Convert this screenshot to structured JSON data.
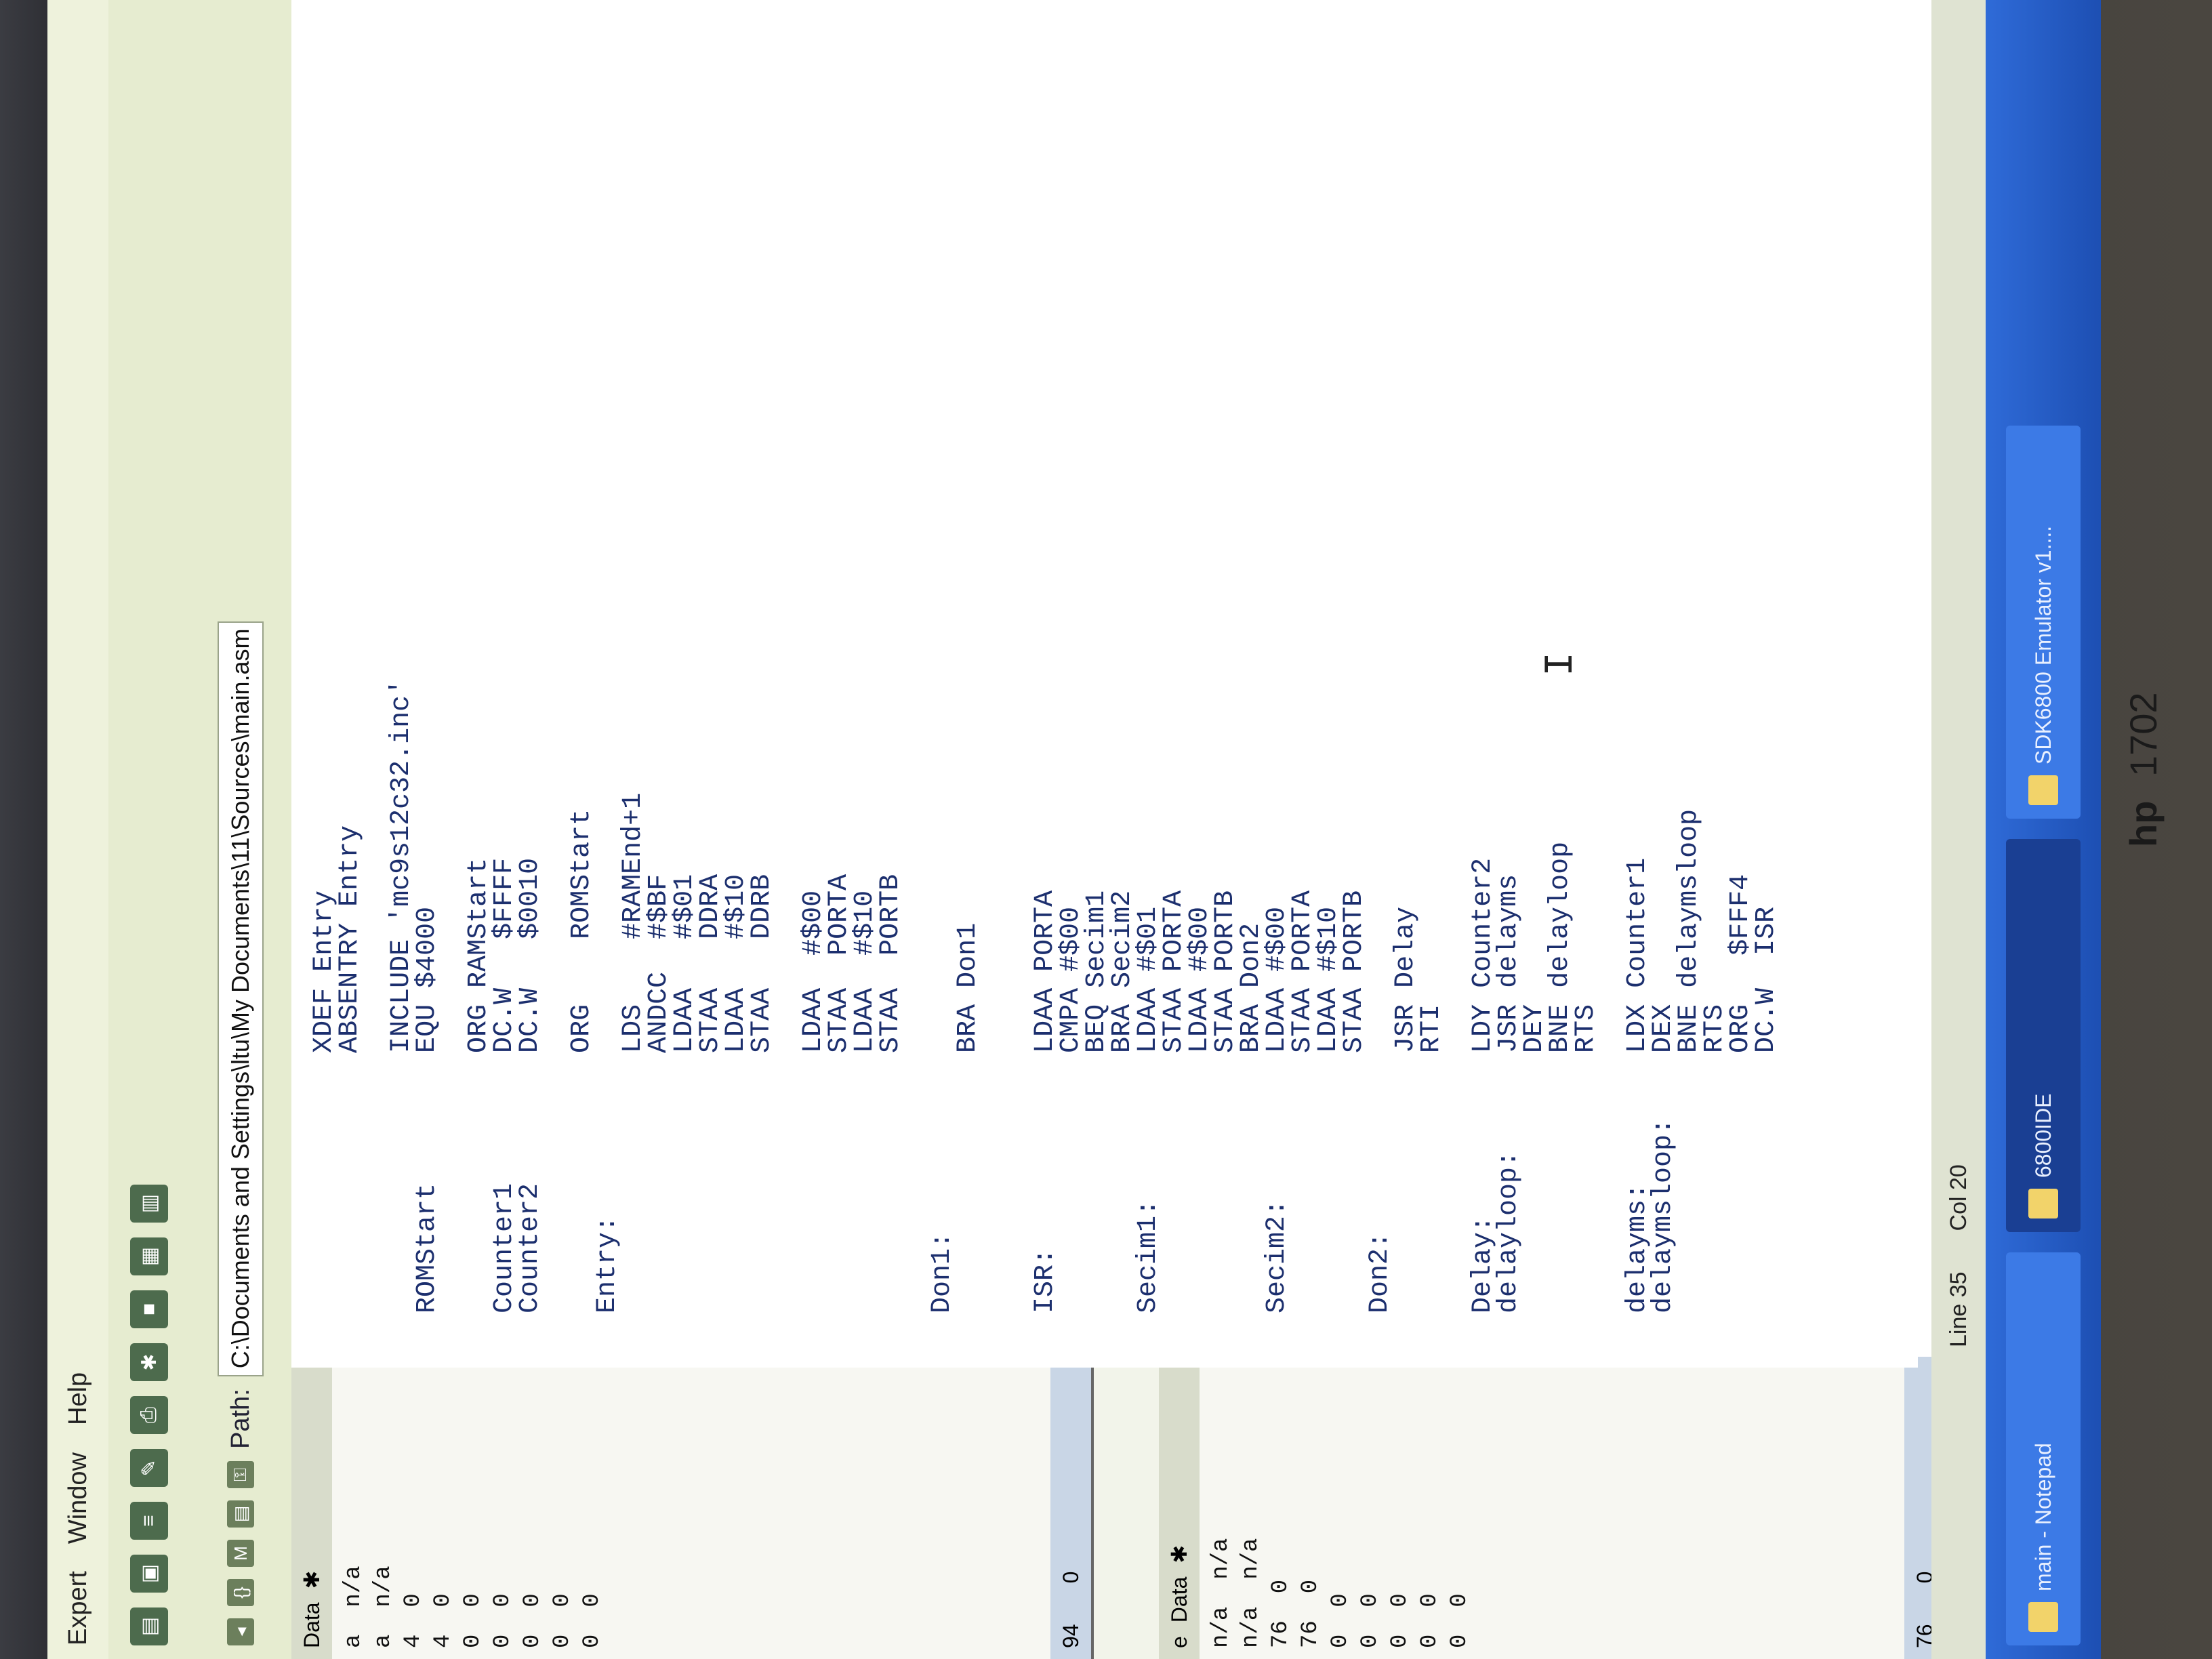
{
  "menu": {
    "items": [
      "Expert",
      "Window",
      "Help"
    ]
  },
  "path": {
    "label": "Path:",
    "value": "C:\\Documents and Settings\\ltu\\My Documents\\11\\Sources\\main.asm"
  },
  "left_panel_top": {
    "header": "Data",
    "rows": [
      {
        "a": "a",
        "b": "n/a"
      },
      {
        "a": "a",
        "b": "n/a"
      },
      {
        "a": "4",
        "b": "0"
      },
      {
        "a": "4",
        "b": "0"
      },
      {
        "a": "0",
        "b": "0"
      },
      {
        "a": "0",
        "b": "0"
      },
      {
        "a": "0",
        "b": "0"
      },
      {
        "a": "0",
        "b": "0"
      },
      {
        "a": "0",
        "b": "0"
      }
    ],
    "footer_a": "94",
    "footer_b": "0"
  },
  "left_panel_bottom": {
    "header": "Data",
    "col_label": "e",
    "rows": [
      {
        "a": "n/a",
        "b": "n/a"
      },
      {
        "a": "n/a",
        "b": "n/a"
      },
      {
        "a": "76",
        "b": "0"
      },
      {
        "a": "76",
        "b": "0"
      },
      {
        "a": "0",
        "b": "0"
      },
      {
        "a": "0",
        "b": "0"
      },
      {
        "a": "0",
        "b": "0"
      },
      {
        "a": "0",
        "b": "0"
      },
      {
        "a": "0",
        "b": "0"
      }
    ],
    "footer_a": "76",
    "footer_b": "0"
  },
  "code_lines": [
    "                XDEF Entry",
    "                ABSENTRY Entry",
    "",
    "                INCLUDE 'mc9s12c32.inc'",
    "ROMStart        EQU $4000",
    "",
    "                ORG RAMStart",
    "Counter1        DC.W   $FFFF",
    "Counter2        DC.W   $0010",
    "",
    "                ORG    ROMStart",
    "Entry:",
    "                LDS    #RAMEnd+1",
    "                ANDCC  #$BF",
    "                LDAA   #$01",
    "                STAA   DDRA",
    "                LDAA   #$10",
    "                STAA   DDRB",
    "",
    "                LDAA  #$00",
    "                STAA  PORTA",
    "                LDAA  #$10",
    "                STAA  PORTB",
    "",
    "Don1:",
    "                BRA Don1",
    "",
    "",
    "ISR:            LDAA PORTA",
    "                CMPA #$00",
    "                BEQ Secim1",
    "                BRA Secim2",
    "Secim1:         LDAA #$01",
    "                STAA PORTA",
    "                LDAA #$00",
    "                STAA PORTB",
    "                BRA Don2",
    "Secim2:         LDAA #$00",
    "                STAA PORTA",
    "                LDAA #$10",
    "                STAA PORTB",
    "Don2:",
    "                JSR Delay",
    "                RTI",
    "",
    "Delay:          LDY Counter2",
    "delayloop:      JSR delayms",
    "                DEY",
    "                BNE delayloop",
    "                RTS",
    "",
    "delayms:        LDX Counter1",
    "delaymsloop:    DEX",
    "                BNE delaymsloop",
    "                RTS",
    "                ORG   $FFF4",
    "                DC.W  ISR"
  ],
  "status": {
    "line": "Line 35",
    "col": "Col 20"
  },
  "taskbar": {
    "items": [
      "main - Notepad",
      "6800IDE",
      "SDK6800 Emulator v1...."
    ]
  },
  "bezel": {
    "brand": "hp",
    "model": "1702"
  }
}
